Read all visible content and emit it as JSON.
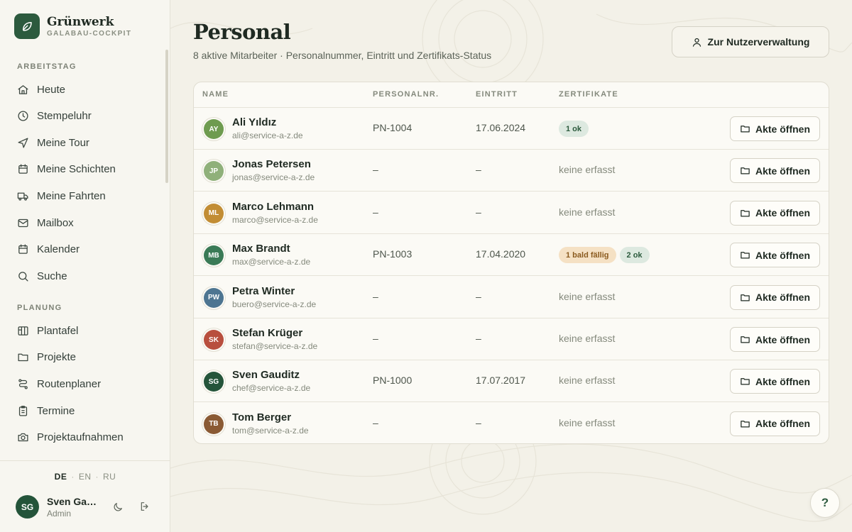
{
  "brand": {
    "name": "Grünwerk",
    "subtitle": "GALABAU-COCKPIT"
  },
  "sidebar": {
    "sections": [
      {
        "title": "ARBEITSTAG"
      },
      {
        "title": "PLANUNG"
      }
    ],
    "items": [
      {
        "label": "Heute",
        "icon": "home-icon"
      },
      {
        "label": "Stempeluhr",
        "icon": "clock-icon"
      },
      {
        "label": "Meine Tour",
        "icon": "navigation-icon"
      },
      {
        "label": "Meine Schichten",
        "icon": "calendar-icon"
      },
      {
        "label": "Meine Fahrten",
        "icon": "truck-icon"
      },
      {
        "label": "Mailbox",
        "icon": "mail-icon"
      },
      {
        "label": "Kalender",
        "icon": "calendar-icon"
      },
      {
        "label": "Suche",
        "icon": "search-icon"
      },
      {
        "label": "Plantafel",
        "icon": "board-icon"
      },
      {
        "label": "Projekte",
        "icon": "folder-icon"
      },
      {
        "label": "Routenplaner",
        "icon": "route-icon"
      },
      {
        "label": "Termine",
        "icon": "clipboard-icon"
      },
      {
        "label": "Projektaufnahmen",
        "icon": "camera-icon"
      }
    ],
    "languages": [
      {
        "code": "DE",
        "active": true
      },
      {
        "code": "EN",
        "active": false
      },
      {
        "code": "RU",
        "active": false
      }
    ],
    "user": {
      "initials": "SG",
      "name": "Sven Gauditz",
      "role": "Admin"
    }
  },
  "header": {
    "title": "Personal",
    "subtitle": "8 aktive Mitarbeiter · Personalnummer, Eintritt und Zertifikats-Status",
    "user_admin_button": "Zur Nutzerverwaltung"
  },
  "table": {
    "columns": [
      "NAME",
      "PERSONALNR.",
      "EINTRITT",
      "ZERTIFIKATE"
    ],
    "open_label": "Akte öffnen",
    "rows": [
      {
        "initials": "AY",
        "avatar_color": "#6e9b4f",
        "name": "Ali Yıldız",
        "email": "ali@service-a-z.de",
        "pn": "PN-1004",
        "entry": "17.06.2024",
        "cert_text": "",
        "badges": [
          {
            "text": "1 ok",
            "kind": "ok"
          }
        ]
      },
      {
        "initials": "JP",
        "avatar_color": "#8fb07a",
        "name": "Jonas Petersen",
        "email": "jonas@service-a-z.de",
        "pn": "–",
        "entry": "–",
        "cert_text": "keine erfasst",
        "badges": []
      },
      {
        "initials": "ML",
        "avatar_color": "#c28d34",
        "name": "Marco Lehmann",
        "email": "marco@service-a-z.de",
        "pn": "–",
        "entry": "–",
        "cert_text": "keine erfasst",
        "badges": []
      },
      {
        "initials": "MB",
        "avatar_color": "#3a7a56",
        "name": "Max Brandt",
        "email": "max@service-a-z.de",
        "pn": "PN-1003",
        "entry": "17.04.2020",
        "cert_text": "",
        "badges": [
          {
            "text": "1 bald fällig",
            "kind": "due"
          },
          {
            "text": "2 ok",
            "kind": "ok"
          }
        ]
      },
      {
        "initials": "PW",
        "avatar_color": "#4d7591",
        "name": "Petra Winter",
        "email": "buero@service-a-z.de",
        "pn": "–",
        "entry": "–",
        "cert_text": "keine erfasst",
        "badges": []
      },
      {
        "initials": "SK",
        "avatar_color": "#b84f3e",
        "name": "Stefan Krüger",
        "email": "stefan@service-a-z.de",
        "pn": "–",
        "entry": "–",
        "cert_text": "keine erfasst",
        "badges": []
      },
      {
        "initials": "SG",
        "avatar_color": "#24543a",
        "name": "Sven Gauditz",
        "email": "chef@service-a-z.de",
        "pn": "PN-1000",
        "entry": "17.07.2017",
        "cert_text": "keine erfasst",
        "badges": []
      },
      {
        "initials": "TB",
        "avatar_color": "#8a5a34",
        "name": "Tom Berger",
        "email": "tom@service-a-z.de",
        "pn": "–",
        "entry": "–",
        "cert_text": "keine erfasst",
        "badges": []
      }
    ]
  },
  "help": {
    "label": "?"
  }
}
